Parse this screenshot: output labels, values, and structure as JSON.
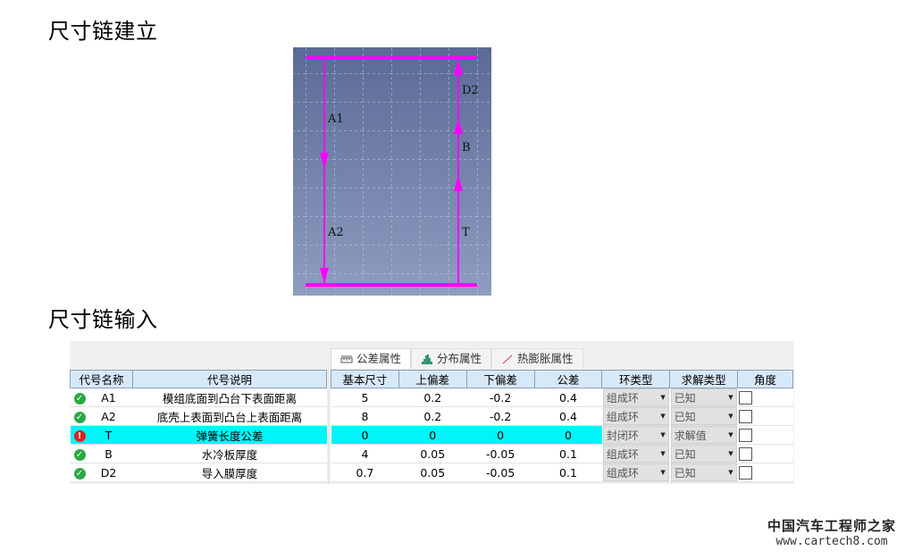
{
  "sections": {
    "build_title": "尺寸链建立",
    "input_title": "尺寸链输入"
  },
  "diagram": {
    "line_color": "#ff00ff",
    "chain": [
      {
        "label": "A1",
        "direction": "down",
        "side": "left"
      },
      {
        "label": "A2",
        "direction": "down",
        "side": "left"
      },
      {
        "label": "T",
        "direction": "up",
        "side": "right"
      },
      {
        "label": "B",
        "direction": "up",
        "side": "right"
      },
      {
        "label": "D2",
        "direction": "up",
        "side": "right"
      }
    ]
  },
  "tabs": [
    {
      "label": "公差属性",
      "icon": "ruler-icon",
      "active": true
    },
    {
      "label": "分布属性",
      "icon": "histogram-icon",
      "active": false
    },
    {
      "label": "热膨胀属性",
      "icon": "line-icon",
      "active": false
    }
  ],
  "left_table": {
    "headers": [
      "代号名称",
      "代号说明"
    ],
    "rows": [
      {
        "status": "ok",
        "code": "A1",
        "desc": "模组底面到凸台下表面距离"
      },
      {
        "status": "ok",
        "code": "A2",
        "desc": "底壳上表面到凸台上表面距离"
      },
      {
        "status": "error",
        "code": "T",
        "desc": "弹簧长度公差"
      },
      {
        "status": "ok",
        "code": "B",
        "desc": "水冷板厚度"
      },
      {
        "status": "ok",
        "code": "D2",
        "desc": "导入膜厚度"
      }
    ]
  },
  "right_table": {
    "headers": [
      "基本尺寸",
      "上偏差",
      "下偏差",
      "公差",
      "环类型",
      "求解类型",
      "角度"
    ],
    "rows": [
      {
        "nominal": "5",
        "upper": "0.2",
        "lower": "-0.2",
        "tol": "0.4",
        "ring": "组成环",
        "solve": "已知",
        "angle": false
      },
      {
        "nominal": "8",
        "upper": "0.2",
        "lower": "-0.2",
        "tol": "0.4",
        "ring": "组成环",
        "solve": "已知",
        "angle": false
      },
      {
        "nominal": "0",
        "upper": "0",
        "lower": "0",
        "tol": "0",
        "ring": "封闭环",
        "solve": "求解值",
        "angle": false
      },
      {
        "nominal": "4",
        "upper": "0.05",
        "lower": "-0.05",
        "tol": "0.1",
        "ring": "组成环",
        "solve": "已知",
        "angle": false
      },
      {
        "nominal": "0.7",
        "upper": "0.05",
        "lower": "-0.05",
        "tol": "0.1",
        "ring": "组成环",
        "solve": "已知",
        "angle": false
      }
    ]
  },
  "highlight_row": 2,
  "highlight_color": "#00f5f8",
  "watermark": {
    "line1": "中国汽车工程师之家",
    "line2": "www.cartech8.com"
  }
}
